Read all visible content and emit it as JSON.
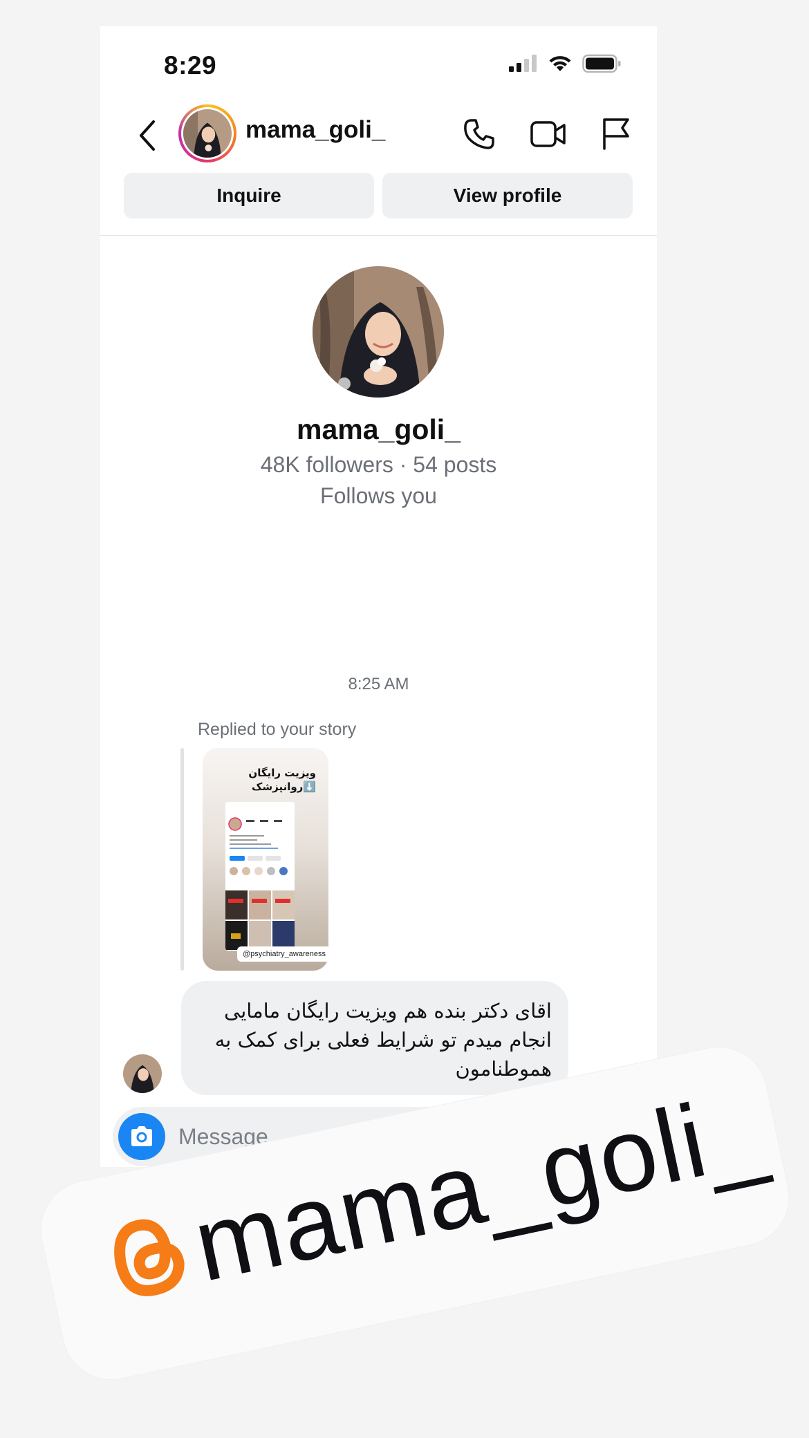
{
  "status_bar": {
    "time": "8:29"
  },
  "header": {
    "username": "mama_goli_",
    "inquire_label": "Inquire",
    "view_profile_label": "View profile"
  },
  "profile": {
    "name": "mama_goli_",
    "stats": "48K followers · 54 posts",
    "follows": "Follows you"
  },
  "conversation": {
    "timestamp": "8:25 AM",
    "reply_label": "Replied to your story",
    "story": {
      "title_line1": "ویزیت رایگان",
      "title_line2": "⬇️روانپزشک",
      "tag": "@psychiatry_awareness"
    },
    "message": "اقای دکتر بنده هم ویزیت رایگان مامایی انجام میدم تو شرایط فعلی برای کمک به هموطنامون"
  },
  "composer": {
    "placeholder": "Message"
  },
  "watermark": {
    "handle": "mama_goli_"
  },
  "colors": {
    "accent_blue": "#1a86f4",
    "threads_orange": "#f57c16",
    "bubble_bg": "#eff0f2"
  }
}
